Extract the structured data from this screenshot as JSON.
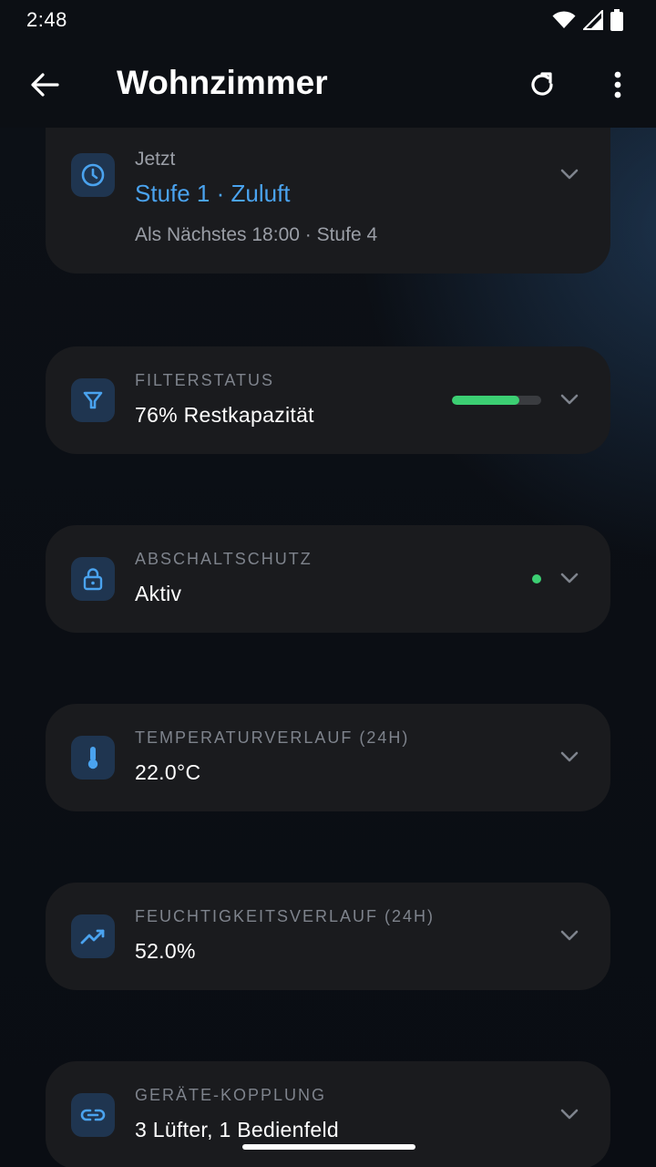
{
  "status_bar": {
    "time": "2:48"
  },
  "app_bar": {
    "title": "Wohnzimmer"
  },
  "now_card": {
    "label": "Jetzt",
    "mode": "Stufe 1 · Zuluft",
    "next": "Als Nächstes 18:00 · Stufe 4"
  },
  "cards": [
    {
      "label": "FILTERSTATUS",
      "value": "76% Restkapazität",
      "progress": 0.76,
      "icon": "filter-icon"
    },
    {
      "label": "ABSCHALTSCHUTZ",
      "value": "Aktiv",
      "icon": "lock-icon"
    },
    {
      "label": "TEMPERATURVERLAUF (24H)",
      "value": "22.0°C",
      "icon": "thermometer-icon"
    },
    {
      "label": "FEUCHTIGKEITSVERLAUF (24H)",
      "value": "52.0%",
      "icon": "trend-icon"
    },
    {
      "label": "GERÄTE-KOPPLUNG",
      "value": "3 Lüfter, 1 Bedienfeld",
      "icon": "link-icon"
    }
  ],
  "colors": {
    "accent": "#4aa3ef",
    "success": "#3ccf73",
    "card": "#1a1b1e",
    "icon_bg": "#1f3550"
  }
}
